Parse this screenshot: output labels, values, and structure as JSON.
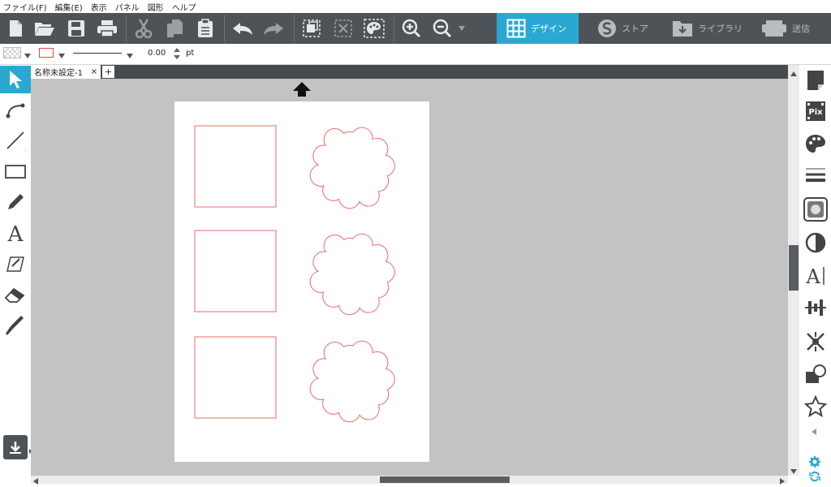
{
  "menu": [
    "ファイル(F)",
    "編集(E)",
    "表示",
    "パネル",
    "図形",
    "ヘルプ"
  ],
  "tabs": [
    {
      "label": "デザイン",
      "icon": "grid-icon",
      "active": true
    },
    {
      "label": "ストア",
      "icon": "store-icon",
      "active": false
    },
    {
      "label": "ライブラリ",
      "icon": "library-icon",
      "active": false
    },
    {
      "label": "送信",
      "icon": "send-icon",
      "active": false
    }
  ],
  "options": {
    "line_width_value": "0.00",
    "line_width_unit": "pt"
  },
  "document": {
    "tab_label": "名称未設定-1",
    "close_glyph": "×",
    "add_glyph": "+"
  },
  "colors": {
    "toolbar_bg": "#4d5357",
    "active_tab": "#2aa8d3",
    "canvas_bg": "#c3c3c3",
    "cut_line": "#ec6b6b"
  }
}
